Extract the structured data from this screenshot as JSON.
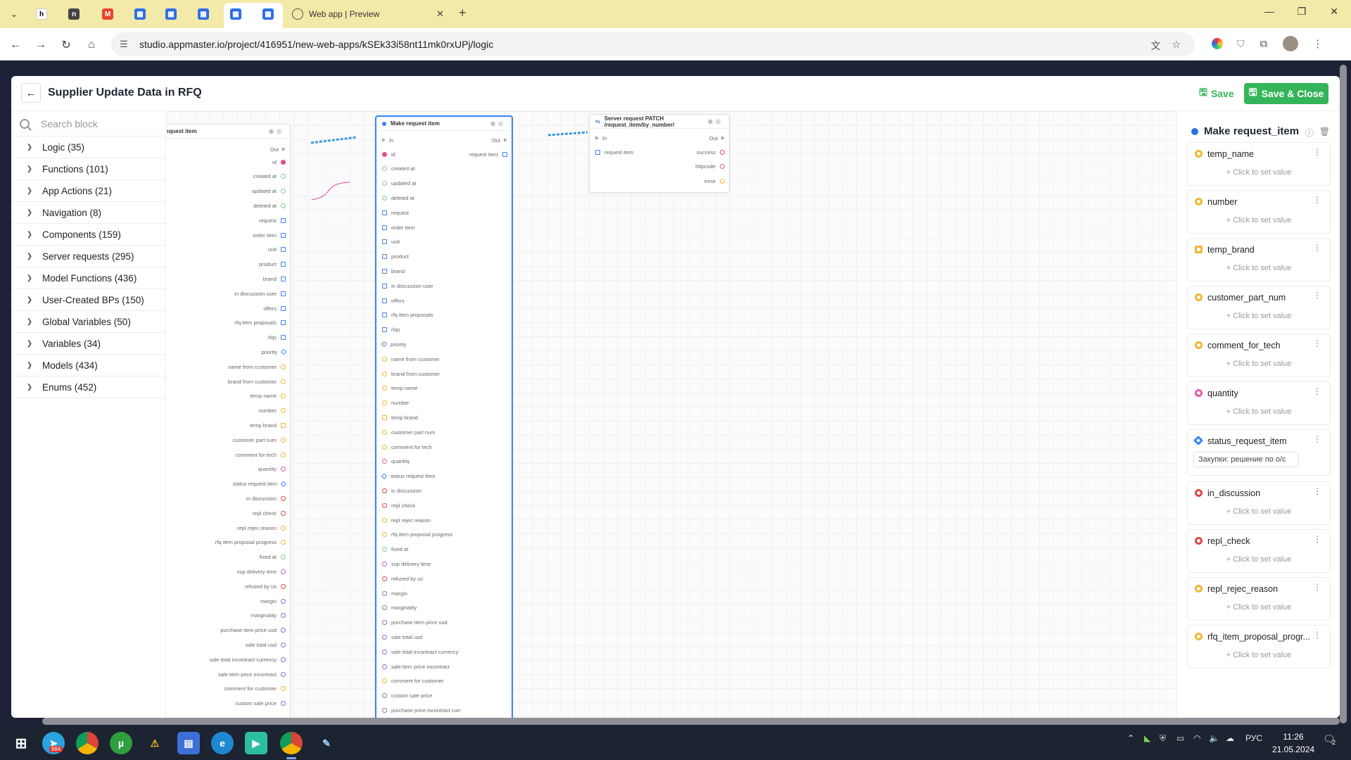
{
  "browser": {
    "tab_title": "Web app | Preview",
    "url": "studio.appmaster.io/project/416951/new-web-apps/kSEk33i58nt11mk0rxUPj/logic"
  },
  "header": {
    "title": "Supplier Update Data in RFQ",
    "save_label": "Save",
    "save_close_label": "Save & Close"
  },
  "sidebar": {
    "search_placeholder": "Search block",
    "categories": [
      {
        "label": "Logic (35)"
      },
      {
        "label": "Functions (101)"
      },
      {
        "label": "App Actions (21)"
      },
      {
        "label": "Navigation (8)"
      },
      {
        "label": "Components (159)"
      },
      {
        "label": "Server requests (295)"
      },
      {
        "label": "Model Functions (436)"
      },
      {
        "label": "User-Created BPs (150)"
      },
      {
        "label": "Global Variables (50)"
      },
      {
        "label": "Variables (34)"
      },
      {
        "label": "Models (434)"
      },
      {
        "label": "Enums (452)"
      }
    ]
  },
  "canvas": {
    "left_node": {
      "title": "request item",
      "out_label": "Out",
      "side_label": "tem",
      "fields": [
        "id",
        "created at",
        "updated at",
        "deleted at",
        "request",
        "order item",
        "unit",
        "product",
        "brand",
        "in discussion user",
        "offers",
        "rfq item proposals",
        "rfqs",
        "priority",
        "name from customer",
        "brand from customer",
        "temp name",
        "number",
        "temp brand",
        "customer part num",
        "comment for tech",
        "quantity",
        "status request item",
        "in discussion",
        "repl check",
        "repl rejec reason",
        "rfq item proposal progress",
        "fixed at",
        "sup delivery time",
        "refused by us",
        "margin",
        "marginality",
        "purchase item price usd",
        "sale total usd",
        "sale total incontract currency",
        "sale item price incontract",
        "comment for customer",
        "custom sale price"
      ]
    },
    "make_node": {
      "title": "Make request item",
      "in_label": "In",
      "out_label": "Out",
      "output_label": "request item",
      "fields": [
        "id",
        "created at",
        "updated at",
        "deleted at",
        "request",
        "order item",
        "unit",
        "product",
        "brand",
        "in discussion user",
        "offers",
        "rfq item proposals",
        "rfqs",
        "priority",
        "name from customer",
        "brand from customer",
        "temp name",
        "number",
        "temp brand",
        "customer part num",
        "comment for tech",
        "quantity",
        "status request item",
        "in discussion",
        "repl check",
        "repl rejec reason",
        "rfq item proposal progress",
        "fixed at",
        "sup delivery time",
        "refused by us",
        "margin",
        "marginality",
        "purchase item price usd",
        "sale total usd",
        "sale total incontract currency",
        "sale item price incontract",
        "comment for customer",
        "custom sale price",
        "purchase price incontract curr"
      ]
    },
    "server_node": {
      "title": "Server request PATCH /request_item/by_number/",
      "in_label": "In",
      "out_label": "Out",
      "input_label": "request item",
      "outputs": [
        "success",
        "httpcode",
        "error"
      ]
    }
  },
  "panel": {
    "title": "Make request_item",
    "params": [
      {
        "name": "temp_name",
        "value": "+ Click to set value"
      },
      {
        "name": "number",
        "value": "+ Click to set value"
      },
      {
        "name": "temp_brand",
        "value": "+ Click to set value"
      },
      {
        "name": "customer_part_num",
        "value": "+ Click to set value"
      },
      {
        "name": "comment_for_tech",
        "value": "+ Click to set value"
      },
      {
        "name": "quantity",
        "value": "+ Click to set value"
      },
      {
        "name": "status_request_item",
        "value": "Закупки: решение по о/с"
      },
      {
        "name": "in_discussion",
        "value": "+ Click to set value"
      },
      {
        "name": "repl_check",
        "value": "+ Click to set value"
      },
      {
        "name": "repl_rejec_reason",
        "value": "+ Click to set value"
      },
      {
        "name": "rfq_item_proposal_progr...",
        "value": "+ Click to set value"
      }
    ]
  },
  "taskbar": {
    "lang": "РУС",
    "time": "11:26",
    "date": "21.05.2024",
    "notif_count": "2",
    "badge": "884"
  }
}
